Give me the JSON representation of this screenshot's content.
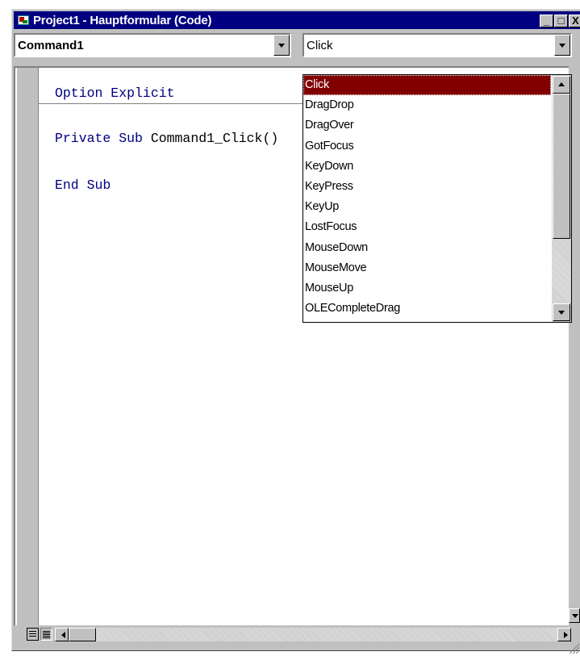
{
  "window": {
    "title": "Project1 - Hauptformular (Code)",
    "controls": {
      "minimize": "_",
      "maximize": "□",
      "close": "X"
    }
  },
  "object_combo": {
    "value": "Command1"
  },
  "procedure_combo": {
    "value": "Click"
  },
  "code": {
    "lines": [
      {
        "kw": "Option Explicit",
        "rest": ""
      },
      {
        "kw": "Private Sub ",
        "rest": "Command1_Click()"
      },
      {
        "kw": "End Sub",
        "rest": ""
      }
    ]
  },
  "event_list": {
    "items": [
      "Click",
      "DragDrop",
      "DragOver",
      "GotFocus",
      "KeyDown",
      "KeyPress",
      "KeyUp",
      "LostFocus",
      "MouseDown",
      "MouseMove",
      "MouseUp",
      "OLECompleteDrag"
    ],
    "selected": "Click"
  },
  "colors": {
    "title_bar": "#000080",
    "selection": "#800000",
    "keyword": "#000080",
    "chrome": "#c0c0c0"
  }
}
